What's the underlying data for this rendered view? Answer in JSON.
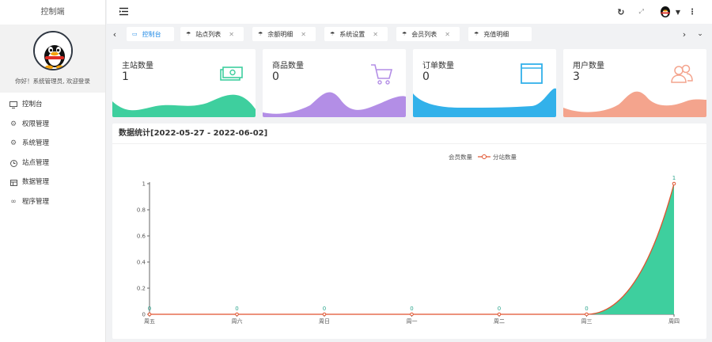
{
  "sidebar": {
    "brand": "控制端",
    "welcome": "你好！系统管理员, 欢迎登录",
    "items": [
      {
        "label": "控制台",
        "icon": "monitor-icon"
      },
      {
        "label": "权限管理",
        "icon": "gear-icon"
      },
      {
        "label": "系统管理",
        "icon": "gear-icon"
      },
      {
        "label": "站点管理",
        "icon": "clock-icon"
      },
      {
        "label": "数据管理",
        "icon": "table-icon"
      },
      {
        "label": "程序管理",
        "icon": "link-icon"
      }
    ]
  },
  "topbar": {
    "icons": [
      "menu-toggle-icon",
      "refresh-icon",
      "fullscreen-icon",
      "user-avatar-icon",
      "dropdown-arrow-icon",
      "more-icon"
    ]
  },
  "tabs": [
    {
      "label": "控制台",
      "active": true
    },
    {
      "label": "站点列表",
      "active": false
    },
    {
      "label": "余额明细",
      "active": false
    },
    {
      "label": "系统设置",
      "active": false
    },
    {
      "label": "会员列表",
      "active": false
    },
    {
      "label": "充值明细",
      "active": false
    }
  ],
  "cards": [
    {
      "label": "主站数量",
      "value": "1",
      "color": "#3ecf9e",
      "icon": "money-icon"
    },
    {
      "label": "商品数量",
      "value": "0",
      "color": "#b38ee6",
      "icon": "cart-icon"
    },
    {
      "label": "订单数量",
      "value": "0",
      "color": "#32b1ea",
      "icon": "window-icon"
    },
    {
      "label": "用户数量",
      "value": "3",
      "color": "#f4a48d",
      "icon": "users-icon"
    }
  ],
  "panel": {
    "title": "数据统计[2022-05-27 - 2022-06-02]"
  },
  "chart_data": {
    "type": "line",
    "categories": [
      "周五",
      "周六",
      "周日",
      "周一",
      "周二",
      "周三",
      "周四"
    ],
    "series": [
      {
        "name": "会员数量",
        "values": [
          0,
          0,
          0,
          0,
          0,
          0,
          1
        ],
        "color": "#3ecf9e",
        "area": true
      },
      {
        "name": "分站数量",
        "values": [
          0,
          0,
          0,
          0,
          0,
          0,
          1
        ],
        "color": "#e0522e",
        "area": false
      }
    ],
    "ylim": [
      0,
      1
    ],
    "yticks": [
      "0",
      "0.2",
      "0.4",
      "0.6",
      "0.8",
      "1"
    ],
    "data_labels": [
      "0",
      "0",
      "0",
      "0",
      "0",
      "0",
      "1"
    ],
    "legend_position": "top"
  }
}
